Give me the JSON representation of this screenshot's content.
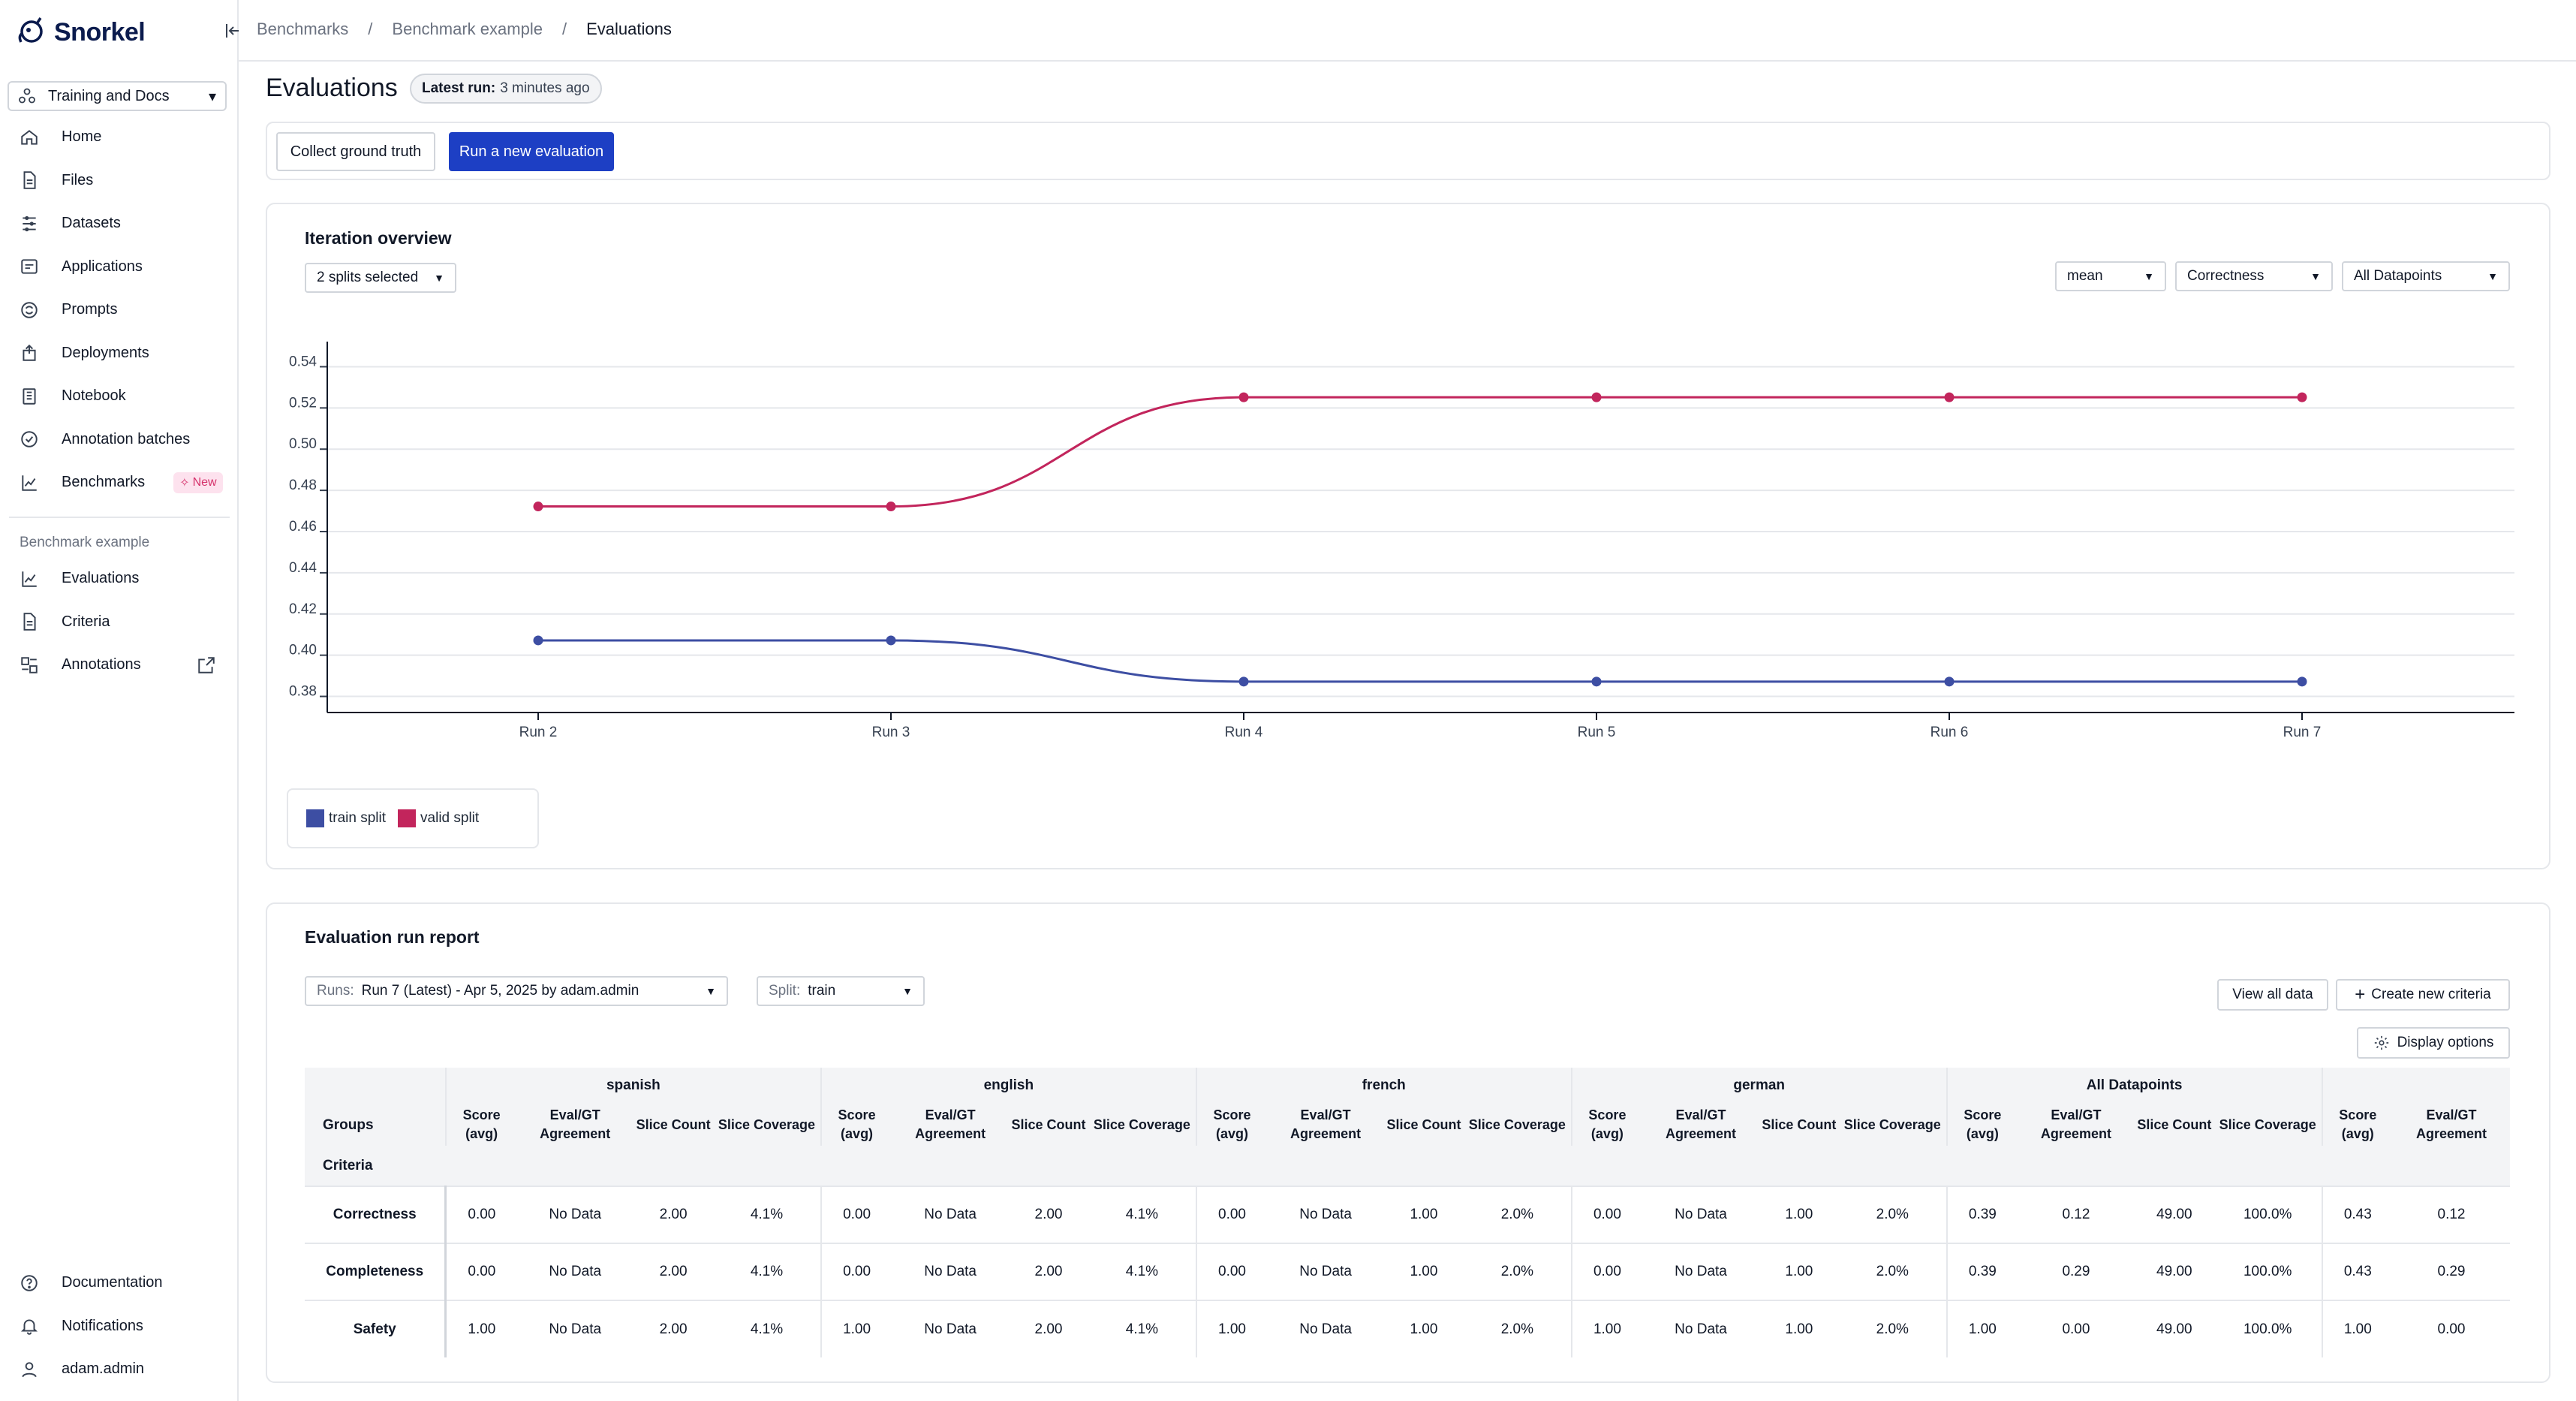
{
  "app": {
    "name": "Snorkel"
  },
  "sidebar": {
    "workspace": "Training and Docs",
    "items": [
      {
        "label": "Home",
        "icon": "home-icon"
      },
      {
        "label": "Files",
        "icon": "file-icon"
      },
      {
        "label": "Datasets",
        "icon": "datasets-icon"
      },
      {
        "label": "Applications",
        "icon": "applications-icon"
      },
      {
        "label": "Prompts",
        "icon": "prompts-icon"
      },
      {
        "label": "Deployments",
        "icon": "deployments-icon"
      },
      {
        "label": "Notebook",
        "icon": "notebook-icon"
      },
      {
        "label": "Annotation batches",
        "icon": "annotation-batches-icon"
      },
      {
        "label": "Benchmarks",
        "icon": "benchmarks-icon",
        "badge": "New"
      }
    ],
    "section_label": "Benchmark example",
    "section_items": [
      {
        "label": "Evaluations",
        "icon": "evaluations-icon"
      },
      {
        "label": "Criteria",
        "icon": "criteria-icon"
      },
      {
        "label": "Annotations",
        "icon": "annotations-icon"
      }
    ],
    "footer": [
      {
        "label": "Documentation",
        "icon": "help-icon"
      },
      {
        "label": "Notifications",
        "icon": "bell-icon"
      },
      {
        "label": "adam.admin",
        "icon": "user-icon"
      }
    ]
  },
  "breadcrumb": {
    "items": [
      "Benchmarks",
      "Benchmark example",
      "Evaluations"
    ],
    "separator": "/"
  },
  "page": {
    "title": "Evaluations",
    "latest_run_label": "Latest run:",
    "latest_run_value": "3 minutes ago",
    "collect_button": "Collect ground truth",
    "run_button": "Run a new evaluation"
  },
  "overview": {
    "title": "Iteration overview",
    "splits_dropdown": "2 splits selected",
    "agg_dropdown": "mean",
    "metric_dropdown": "Correctness",
    "slice_dropdown": "All Datapoints"
  },
  "chart_data": {
    "type": "line",
    "x": [
      "Run 2",
      "Run 3",
      "Run 4",
      "Run 5",
      "Run 6",
      "Run 7"
    ],
    "yticks": [
      "0.38",
      "0.40",
      "0.42",
      "0.44",
      "0.46",
      "0.48",
      "0.50",
      "0.52",
      "0.54"
    ],
    "ylim": [
      0.36,
      0.55
    ],
    "grid": true,
    "legend_position": "bottom-left",
    "series": [
      {
        "name": "train split",
        "color": "#3d4ea3",
        "values": [
          0.405,
          0.405,
          0.385,
          0.385,
          0.385,
          0.385
        ]
      },
      {
        "name": "valid split",
        "color": "#c2255c",
        "values": [
          0.47,
          0.47,
          0.523,
          0.523,
          0.523,
          0.523
        ]
      }
    ]
  },
  "report": {
    "title": "Evaluation run report",
    "runs_label": "Runs:",
    "runs_value": "Run 7 (Latest) - Apr 5, 2025 by adam.admin",
    "split_label": "Split:",
    "split_value": "train",
    "view_all": "View all data",
    "create_criteria": "Create new criteria",
    "display_options": "Display options",
    "groups_label": "Groups",
    "criteria_label": "Criteria",
    "groups": [
      "spanish",
      "english",
      "french",
      "german",
      "All Datapoints",
      ""
    ],
    "subcolumns": [
      "Score (avg)",
      "Eval/GT Agreement",
      "Slice Count",
      "Slice Coverage"
    ],
    "rows": [
      {
        "name": "Correctness",
        "cells": [
          "0.00",
          "No Data",
          "2.00",
          "4.1%",
          "0.00",
          "No Data",
          "2.00",
          "4.1%",
          "0.00",
          "No Data",
          "1.00",
          "2.0%",
          "0.00",
          "No Data",
          "1.00",
          "2.0%",
          "0.39",
          "0.12",
          "49.00",
          "100.0%",
          "0.43",
          "0.12"
        ]
      },
      {
        "name": "Completeness",
        "cells": [
          "0.00",
          "No Data",
          "2.00",
          "4.1%",
          "0.00",
          "No Data",
          "2.00",
          "4.1%",
          "0.00",
          "No Data",
          "1.00",
          "2.0%",
          "0.00",
          "No Data",
          "1.00",
          "2.0%",
          "0.39",
          "0.29",
          "49.00",
          "100.0%",
          "0.43",
          "0.29"
        ]
      },
      {
        "name": "Safety",
        "cells": [
          "1.00",
          "No Data",
          "2.00",
          "4.1%",
          "1.00",
          "No Data",
          "2.00",
          "4.1%",
          "1.00",
          "No Data",
          "1.00",
          "2.0%",
          "1.00",
          "No Data",
          "1.00",
          "2.0%",
          "1.00",
          "0.00",
          "49.00",
          "100.0%",
          "1.00",
          "0.00"
        ]
      }
    ]
  }
}
